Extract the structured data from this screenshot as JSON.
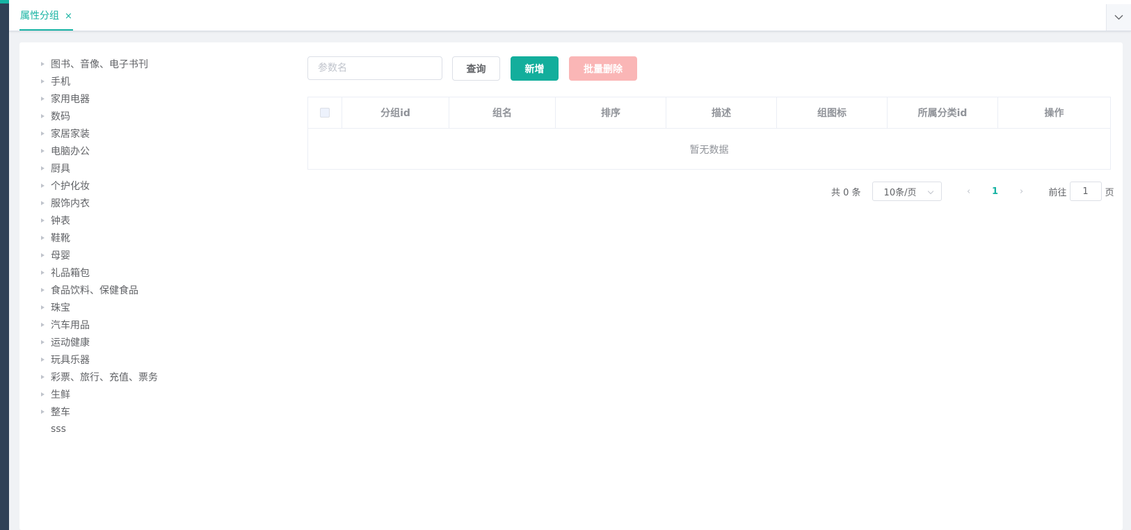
{
  "tabs": {
    "active_label": "属性分组",
    "close_glyph": "×"
  },
  "tree": {
    "nodes": [
      {
        "label": "图书、音像、电子书刊",
        "has_children": true
      },
      {
        "label": "手机",
        "has_children": true
      },
      {
        "label": "家用电器",
        "has_children": true
      },
      {
        "label": "数码",
        "has_children": true
      },
      {
        "label": "家居家装",
        "has_children": true
      },
      {
        "label": "电脑办公",
        "has_children": true
      },
      {
        "label": "厨具",
        "has_children": true
      },
      {
        "label": "个护化妆",
        "has_children": true
      },
      {
        "label": "服饰内衣",
        "has_children": true
      },
      {
        "label": "钟表",
        "has_children": true
      },
      {
        "label": "鞋靴",
        "has_children": true
      },
      {
        "label": "母婴",
        "has_children": true
      },
      {
        "label": "礼品箱包",
        "has_children": true
      },
      {
        "label": "食品饮料、保健食品",
        "has_children": true
      },
      {
        "label": "珠宝",
        "has_children": true
      },
      {
        "label": "汽车用品",
        "has_children": true
      },
      {
        "label": "运动健康",
        "has_children": true
      },
      {
        "label": "玩具乐器",
        "has_children": true
      },
      {
        "label": "彩票、旅行、充值、票务",
        "has_children": true
      },
      {
        "label": "生鲜",
        "has_children": true
      },
      {
        "label": "整车",
        "has_children": true
      },
      {
        "label": "sss",
        "has_children": false
      }
    ]
  },
  "toolbar": {
    "search_placeholder": "参数名",
    "search_value": "",
    "query_label": "查询",
    "add_label": "新增",
    "batch_delete_label": "批量删除"
  },
  "table": {
    "columns": [
      "分组id",
      "组名",
      "排序",
      "描述",
      "组图标",
      "所属分类id",
      "操作"
    ],
    "empty_text": "暂无数据"
  },
  "pagination": {
    "total_text": "共 0 条",
    "page_size_text": "10条/页",
    "current_page": "1",
    "prev_glyph": "‹",
    "next_glyph": "›",
    "goto_label": "前往",
    "goto_value": "1",
    "goto_suffix": "页"
  },
  "icons": {
    "tab_dropdown": "chevron-down-icon",
    "tree_caret": "caret-right-icon"
  },
  "colors": {
    "primary": "#17b3a3",
    "danger_disabled": "#fab6b6",
    "sidebar": "#304156"
  }
}
